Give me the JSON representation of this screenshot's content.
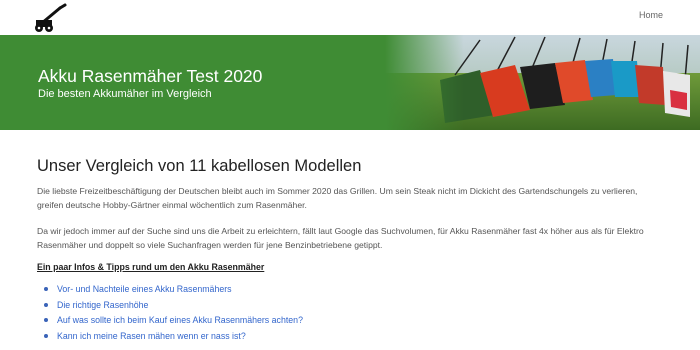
{
  "nav": {
    "home_label": "Home"
  },
  "hero": {
    "title": "Akku Rasenmäher Test 2020",
    "subtitle": "Die besten Akkumäher im Vergleich"
  },
  "main": {
    "heading": "Unser Vergleich von 11 kabellosen Modellen",
    "paragraphs": [
      "Die liebste Freizeitbeschäftigung der Deutschen bleibt auch im Sommer 2020 das Grillen. Um sein Steak nicht im Dickicht des Gartendschungels zu verlieren, greifen deutsche Hobby-Gärtner einmal wöchentlich zum Rasenmäher.",
      "Da wir jedoch immer auf der Suche sind uns die Arbeit zu erleichtern, fällt laut Google das Suchvolumen, für Akku Rasenmäher fast 4x höher aus als für Elektro Rasenmäher und doppelt so viele Suchanfragen werden für jene Benzinbetriebene getippt."
    ],
    "tips_heading": "Ein paar Infos & Tipps rund um den Akku Rasenmäher",
    "toc": [
      "Vor- und Nachteile eines Akku Rasenmähers",
      "Die richtige Rasenhöhe",
      "Auf was sollte ich beim Kauf eines Akku Rasenmähers achten?",
      "Kann ich meine Rasen mähen wenn er nass ist?"
    ]
  },
  "colors": {
    "hero_green": "#3f8c34",
    "link_blue": "#3366cc",
    "text_gray": "#555555"
  },
  "icons": {
    "logo": "lawnmower-icon"
  }
}
